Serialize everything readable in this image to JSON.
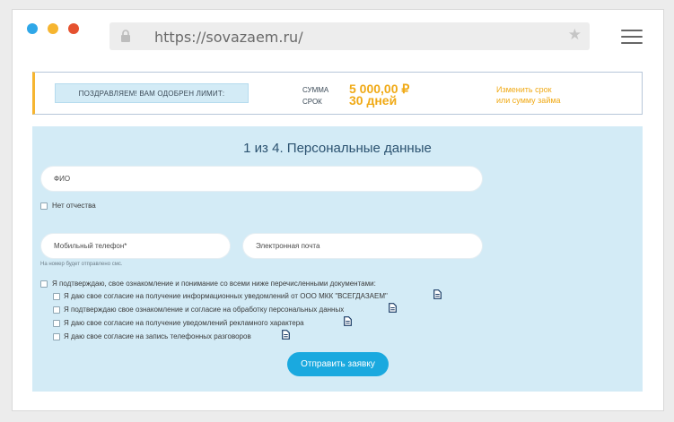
{
  "browser": {
    "url": "https://sovazaem.ru/",
    "dot_colors": [
      "#2fa7e8",
      "#f6b530",
      "#e5512f"
    ]
  },
  "banner": {
    "approved_text": "ПОЗДРАВЛЯЕМ! ВАМ ОДОБРЕН ЛИМИТ:",
    "sum_label": "СУММА",
    "sum_value": "5 000,00 ₽",
    "term_label": "СРОК",
    "term_value": "30 дней",
    "change_line1": "Изменить срок",
    "change_line2": "или сумму займа"
  },
  "form": {
    "title": "1 из 4. Персональные данные",
    "fio_placeholder": "ФИО",
    "no_patronymic": "Нет отчества",
    "phone_placeholder": "Мобильный телефон*",
    "email_placeholder": "Электронная почта",
    "sms_hint": "На номер будет отправлено смс.",
    "confirm_all": "Я подтверждаю, свое ознакомление и понимание со всеми ниже перечисленными документами:",
    "consents": [
      "Я даю свое согласие на получение информационных уведомлений от ООО МКК \"ВСЕГДАЗАЕМ\"",
      "Я подтверждаю свое ознакомление и согласие на обработку персональных данных",
      "Я даю свое согласие на получение уведомлений рекламного характера",
      "Я даю свое согласие на запись телефонных разговоров"
    ],
    "submit_label": "Отправить заявку"
  },
  "colors": {
    "accent_orange": "#f0aa17",
    "button_blue": "#1aa9df",
    "form_bg": "#d3ebf6"
  }
}
